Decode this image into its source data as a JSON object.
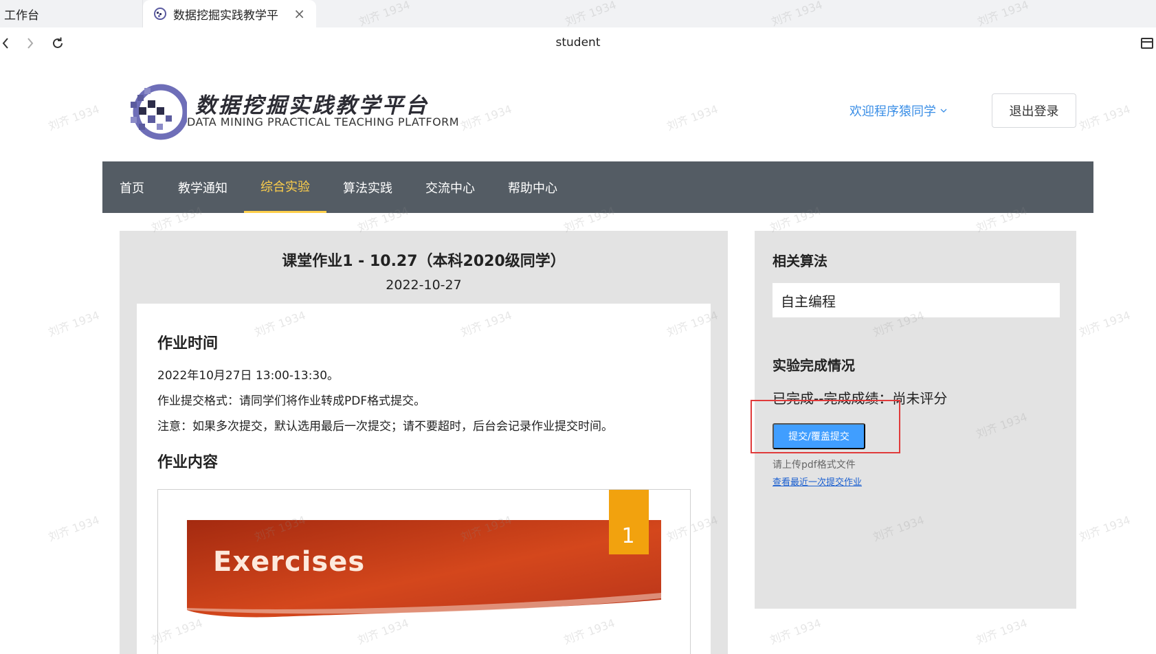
{
  "browser": {
    "tabs": [
      {
        "label": "工作台"
      },
      {
        "label": "数据挖掘实践教学平"
      }
    ],
    "address": "student"
  },
  "header": {
    "title": "数据挖掘实践教学平台",
    "subtitle": "DATA MINING PRACTICAL TEACHING PLATFORM",
    "welcome": "欢迎程序猿同学",
    "logout": "退出登录"
  },
  "nav": {
    "items": [
      {
        "label": "首页"
      },
      {
        "label": "教学通知"
      },
      {
        "label": "综合实验",
        "active": true
      },
      {
        "label": "算法实践"
      },
      {
        "label": "交流中心"
      },
      {
        "label": "帮助中心"
      }
    ]
  },
  "assignment": {
    "title": "课堂作业1 - 10.27（本科2020级同学）",
    "date": "2022-10-27",
    "time_heading": "作业时间",
    "lines": [
      "2022年10月27日 13:00-13:30。",
      "作业提交格式：请同学们将作业转成PDF格式提交。",
      "注意：如果多次提交，默认选用最后一次提交；请不要超时，后台会记录作业提交时间。"
    ],
    "content_heading": "作业内容",
    "slide": {
      "text": "Exercises",
      "number": "1"
    }
  },
  "sidebar": {
    "algo_heading": "相关算法",
    "algo_value": "自主编程",
    "status_heading": "实验完成情况",
    "status_text": "已完成--完成成绩：尚未评分",
    "submit_label": "提交/覆盖提交",
    "hint": "请上传pdf格式文件",
    "view_link": "查看最近一次提交作业"
  },
  "watermark": "刘齐 1934",
  "colors": {
    "nav_bg": "#545c64",
    "nav_active": "#ffd04b",
    "primary": "#409eff",
    "link": "#3a8ee6",
    "highlight": "#e03a3a"
  }
}
